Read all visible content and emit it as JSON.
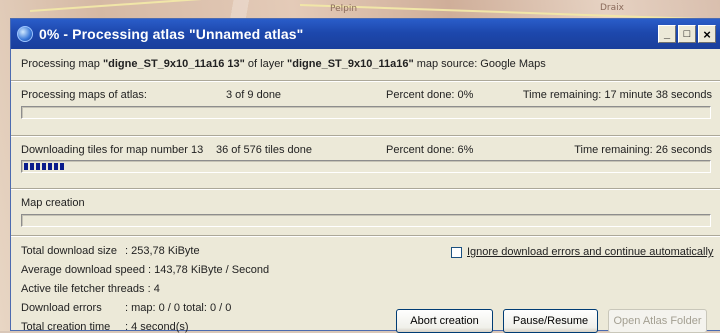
{
  "background": {
    "labels": [
      "Pelpin",
      "Draix"
    ]
  },
  "window": {
    "title": "0% - Processing atlas \"Unnamed atlas\"",
    "buttons": {
      "minimize": "_",
      "maximize": "□",
      "close": "×"
    }
  },
  "processing": {
    "prefix": "Processing map ",
    "map_name": "\"digne_ST_9x10_11a16 13\"",
    "mid": " of layer ",
    "layer_name": "\"digne_ST_9x10_11a16\"",
    "suffix": " map source: Google Maps"
  },
  "maps_of_atlas": {
    "label": "Processing maps of atlas:",
    "count": "3 of 9 done",
    "percent": "Percent done: 0%",
    "time": "Time remaining: 17 minute 38 seconds",
    "progress": 0.0
  },
  "tiles": {
    "label": "Downloading tiles for map number 13",
    "count": "36 of 576 tiles done",
    "percent": "Percent done: 6%",
    "time": "Time remaining: 26 seconds",
    "progress": 0.06
  },
  "map_creation": {
    "label": "Map creation",
    "progress": 0.0
  },
  "stats": [
    {
      "label": "Total download size",
      "value": ": 253,78 KiByte"
    },
    {
      "label": "Average download speed",
      "value": ": 143,78 KiByte / Second"
    },
    {
      "label": "Active tile fetcher threads",
      "value": ": 4"
    },
    {
      "label": "Download errors",
      "value": ": map: 0 / 0 total: 0 / 0"
    },
    {
      "label": "Total creation time",
      "value": ": 4 second(s)"
    }
  ],
  "ignore_errors": {
    "label": "Ignore download errors and continue automatically",
    "checked": false
  },
  "actions": {
    "abort": "Abort creation",
    "pause": "Pause/Resume",
    "open_folder": "Open Atlas Folder"
  }
}
